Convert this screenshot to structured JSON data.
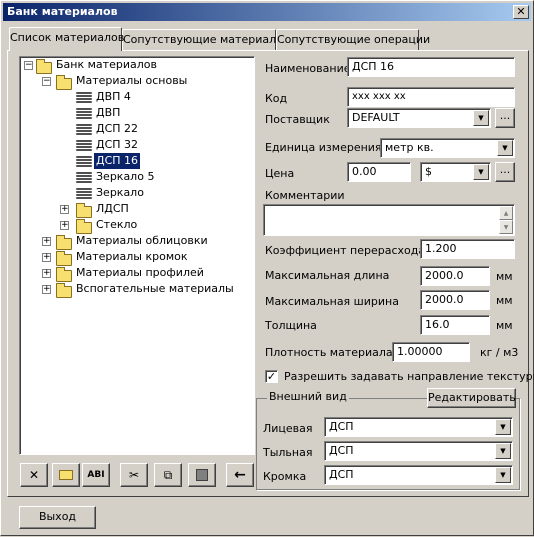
{
  "window": {
    "title": "Банк материалов"
  },
  "tabs": [
    {
      "label": "Список материалов"
    },
    {
      "label": "Сопутствующие материалы"
    },
    {
      "label": "Сопутствующие операции"
    }
  ],
  "tree": {
    "root": "Банк материалов",
    "base": "Материалы основы",
    "items": [
      "ДВП 4",
      "ДВП",
      "ДСП 22",
      "ДСП 32",
      "ДСП 16",
      "Зеркало 5",
      "Зеркало",
      "ЛДСП",
      "Стекло"
    ],
    "groups": [
      "Материалы облицовки",
      "Материалы кромок",
      "Материалы профилей",
      "Вспогательные материалы"
    ]
  },
  "form": {
    "name_label": "Наименование",
    "name_value": "ДСП 16",
    "code_label": "Код",
    "code_value": "xxx xxx xx",
    "supplier_label": "Поставщик",
    "supplier_value": "DEFAULT",
    "unit_label": "Единица измерения",
    "unit_value": "метр кв.",
    "price_label": "Цена",
    "price_value": "0.00",
    "currency_value": "$",
    "comments_label": "Комментарии",
    "waste_label": "Коэффициент перерасхода",
    "waste_value": "1.200",
    "maxlen_label": "Максимальная длина",
    "maxlen_value": "2000.0",
    "maxwid_label": "Максимальная ширина",
    "maxwid_value": "2000.0",
    "thick_label": "Толщина",
    "thick_value": "16.0",
    "unit_mm": "мм",
    "density_label": "Плотность материала",
    "density_value": "1.00000",
    "density_unit": "кг / м3",
    "texture_label": "Разрешить задавать направление текстуры",
    "texture_checked": true
  },
  "appearance": {
    "title": "Внешний вид",
    "edit_button": "Редактировать",
    "face_label": "Лицевая",
    "face_value": "ДСП",
    "back_label": "Тыльная",
    "back_value": "ДСП",
    "edge_label": "Кромка",
    "edge_value": "ДСП"
  },
  "footer": {
    "exit_button": "Выход"
  },
  "ellipsis": "...",
  "tree_expander": {
    "expanded": "−",
    "collapsed": "+"
  },
  "glyphs": {
    "close": "✕",
    "dropdown": "▼",
    "spin_up": "▲",
    "spin_down": "▼",
    "checked": "✓",
    "delete": "✕",
    "abl": "ABI",
    "cut": "✂",
    "copy": "⧉",
    "back_arrow": "←"
  },
  "toolbar_icons": [
    "delete-icon",
    "new-folder-icon",
    "rename-icon",
    "cut-icon",
    "copy-icon",
    "paste-icon",
    "back-arrow-icon"
  ]
}
